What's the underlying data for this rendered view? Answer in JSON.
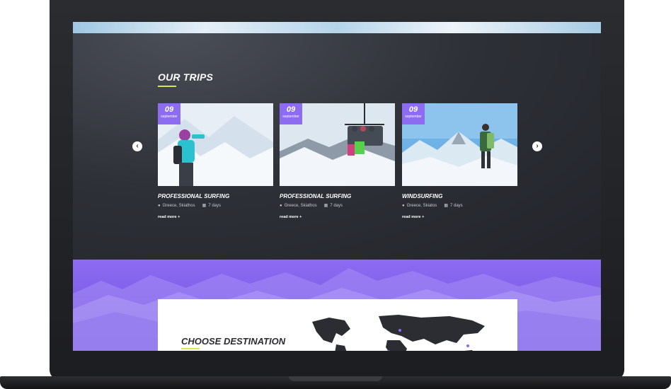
{
  "trips_section": {
    "title": "OUR TRIPS",
    "cards": [
      {
        "day": "09",
        "month": "september",
        "title": "PROFESSIONAL SURFING",
        "location": "Greece, Skiathos",
        "duration": "7 days",
        "link": "read more +"
      },
      {
        "day": "09",
        "month": "september",
        "title": "PROFESSIONAL SURFING",
        "location": "Greece, Skiathos",
        "duration": "7 days",
        "link": "read more +"
      },
      {
        "day": "09",
        "month": "september",
        "title": "WINDSURFING",
        "location": "Greece, Skiatos",
        "duration": "7 days",
        "link": "read more +"
      }
    ]
  },
  "destination_section": {
    "title": "CHOOSE DESTINATION"
  },
  "colors": {
    "accent": "#8d6cf1",
    "underline": "#d7e84a",
    "dark_bg": "#2a2c31"
  },
  "icons": {
    "prev": "chevron-left-icon",
    "next": "chevron-right-icon",
    "location": "map-pin-icon",
    "calendar": "calendar-icon"
  }
}
